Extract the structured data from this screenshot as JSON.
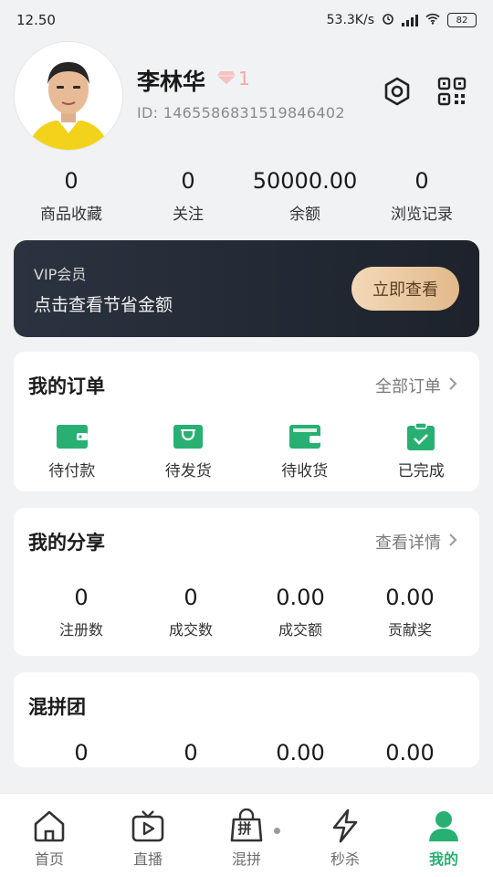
{
  "status_bar": {
    "time": "12.50",
    "network_speed": "53.3K/s",
    "battery": "82"
  },
  "profile": {
    "name": "李林华",
    "level": "1",
    "id_text": "ID: 1465586831519846402"
  },
  "stats": [
    {
      "value": "0",
      "label": "商品收藏"
    },
    {
      "value": "0",
      "label": "关注"
    },
    {
      "value": "50000.00",
      "label": "余额"
    },
    {
      "value": "0",
      "label": "浏览记录"
    }
  ],
  "vip": {
    "title": "VIP会员",
    "subtitle": "点击查看节省金额",
    "button": "立即查看"
  },
  "orders": {
    "title": "我的订单",
    "link": "全部订单",
    "items": [
      {
        "label": "待付款",
        "icon": "wallet-icon"
      },
      {
        "label": "待发货",
        "icon": "package-icon"
      },
      {
        "label": "待收货",
        "icon": "receive-icon"
      },
      {
        "label": "已完成",
        "icon": "check-clipboard-icon"
      }
    ]
  },
  "share": {
    "title": "我的分享",
    "link": "查看详情",
    "metrics": [
      {
        "value": "0",
        "label": "注册数"
      },
      {
        "value": "0",
        "label": "成交数"
      },
      {
        "value": "0.00",
        "label": "成交额"
      },
      {
        "value": "0.00",
        "label": "贡献奖"
      }
    ]
  },
  "group": {
    "title": "混拼团",
    "metrics": [
      {
        "value": "0"
      },
      {
        "value": "0"
      },
      {
        "value": "0.00"
      },
      {
        "value": "0.00"
      }
    ]
  },
  "tabbar": {
    "items": [
      {
        "label": "首页",
        "icon": "home-icon"
      },
      {
        "label": "直播",
        "icon": "live-tv-icon"
      },
      {
        "label": "混拼",
        "icon": "group-bag-icon",
        "badge_char": "拼"
      },
      {
        "label": "秒杀",
        "icon": "flash-icon"
      },
      {
        "label": "我的",
        "icon": "user-icon"
      }
    ],
    "active": "我的"
  },
  "colors": {
    "accent_green": "#27b072",
    "vip_dark": "#232a35",
    "vip_gold": "#e8c39b"
  }
}
